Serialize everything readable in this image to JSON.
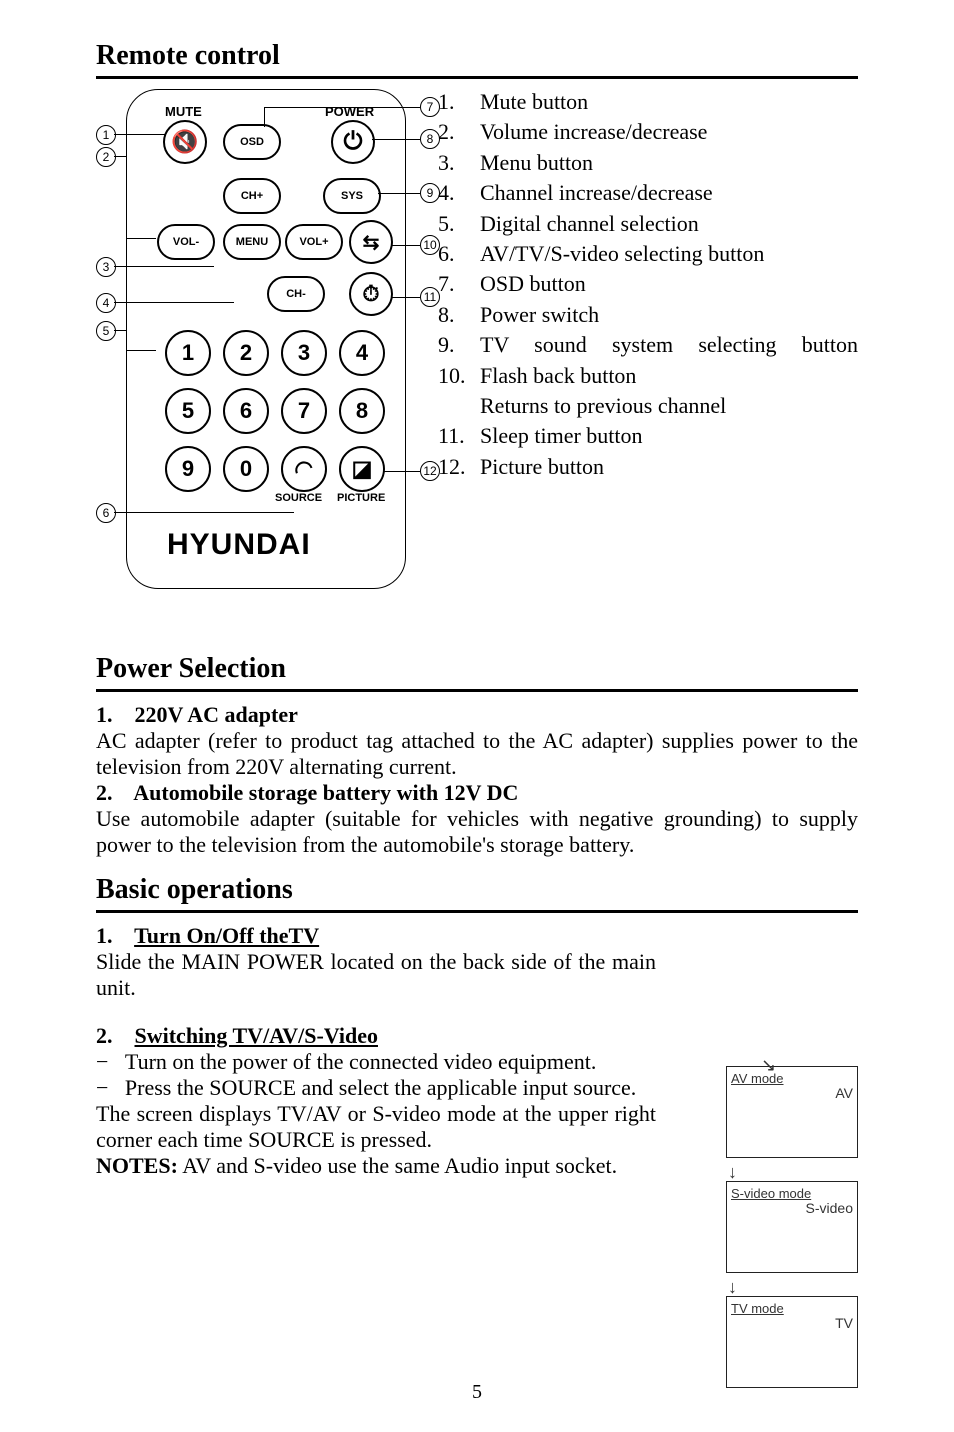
{
  "title_remote": "Remote control",
  "remote": {
    "mute_label": "MUTE",
    "power_label": "POWER",
    "osd_label": "OSD",
    "chplus": "CH+",
    "chminus": "CH-",
    "sys": "SYS",
    "volminus": "VOL-",
    "volplus": "VOL+",
    "menu": "MENU",
    "source_lbl": "SOURCE",
    "picture_lbl": "PICTURE",
    "brand": "HYUNDAI",
    "digits": [
      "1",
      "2",
      "3",
      "4",
      "5",
      "6",
      "7",
      "8",
      "9",
      "0"
    ]
  },
  "callouts_left": [
    "1",
    "2",
    "3",
    "4",
    "5",
    "6"
  ],
  "callouts_right": [
    "7",
    "8",
    "9",
    "10",
    "11",
    "12"
  ],
  "list": [
    {
      "n": "1.",
      "t": "Mute button"
    },
    {
      "n": "2.",
      "t": "Volume increase/decrease"
    },
    {
      "n": "3.",
      "t": "Menu button"
    },
    {
      "n": "4.",
      "t": "Channel increase/decrease"
    },
    {
      "n": "5.",
      "t": "Digital channel selection"
    },
    {
      "n": "6.",
      "t": "AV/TV/S-video selecting button"
    },
    {
      "n": "7.",
      "t": "OSD button"
    },
    {
      "n": "8.",
      "t": "Power switch"
    },
    {
      "n": "9.",
      "t": "TV sound system selecting button"
    },
    {
      "n": "10.",
      "t": "Flash back button"
    },
    {
      "n": "",
      "t": "Returns to previous channel"
    },
    {
      "n": "11.",
      "t": "Sleep timer button"
    },
    {
      "n": "12.",
      "t": "Picture button"
    }
  ],
  "title_power": "Power Selection",
  "power": {
    "l1": "1.    220V AC adapter",
    "p1": "AC adapter (refer to product tag attached to the AC adapter) supplies power to the television from 220V alternating current.",
    "l2": "2.    Automobile storage battery with 12V DC",
    "p2": "Use automobile adapter (suitable for vehicles with negative grounding) to supply power to the television from the automobile's storage battery."
  },
  "title_basic": "Basic operations",
  "basic": {
    "h1n": "1.",
    "h1t": "Turn On/Off theTV",
    "p1": "Slide the MAIN POWER located on the back side of the main unit.",
    "h2n": "2.",
    "h2t": "Switching TV/AV/S-Video",
    "b1": "Turn on the power of the connected video equipment.",
    "b2": "Press the SOURCE and select the applicable input source.",
    "p2": "The screen displays TV/AV or S-video mode at the upper right corner each time SOURCE is pressed.",
    "notes_lbl": "NOTES:",
    "notes": " AV and S-video use the same Audio input socket."
  },
  "modes": {
    "av_title": "AV mode",
    "av_val": "AV",
    "sv_title": "S-video mode",
    "sv_val": "S-video",
    "tv_title": "TV mode",
    "tv_val": "TV",
    "arrow": "↓"
  },
  "page": "5"
}
